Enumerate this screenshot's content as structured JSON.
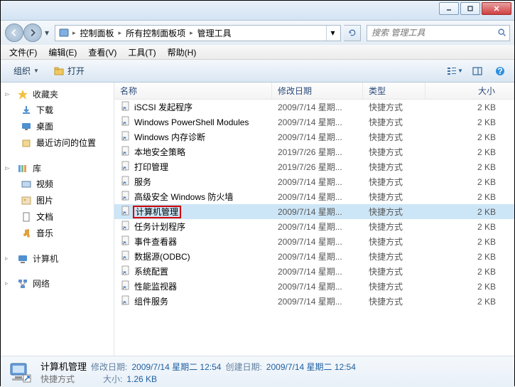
{
  "titlebar": {},
  "nav": {
    "breadcrumb": [
      "控制面板",
      "所有控制面板项",
      "管理工具"
    ],
    "search_placeholder": "搜索 管理工具"
  },
  "menu": {
    "file": "文件(F)",
    "edit": "编辑(E)",
    "view": "查看(V)",
    "tools": "工具(T)",
    "help": "帮助(H)"
  },
  "toolbar": {
    "organize": "组织",
    "open": "打开"
  },
  "sidebar": {
    "favorites": {
      "label": "收藏夹",
      "items": [
        "下载",
        "桌面",
        "最近访问的位置"
      ]
    },
    "libraries": {
      "label": "库",
      "items": [
        "视频",
        "图片",
        "文档",
        "音乐"
      ]
    },
    "computer": {
      "label": "计算机"
    },
    "network": {
      "label": "网络"
    }
  },
  "columns": {
    "name": "名称",
    "date": "修改日期",
    "type": "类型",
    "size": "大小"
  },
  "files": [
    {
      "name": "iSCSI 发起程序",
      "date": "2009/7/14 星期...",
      "type": "快捷方式",
      "size": "2 KB"
    },
    {
      "name": "Windows PowerShell Modules",
      "date": "2009/7/14 星期...",
      "type": "快捷方式",
      "size": "2 KB"
    },
    {
      "name": "Windows 内存诊断",
      "date": "2009/7/14 星期...",
      "type": "快捷方式",
      "size": "2 KB"
    },
    {
      "name": "本地安全策略",
      "date": "2019/7/26 星期...",
      "type": "快捷方式",
      "size": "2 KB"
    },
    {
      "name": "打印管理",
      "date": "2019/7/26 星期...",
      "type": "快捷方式",
      "size": "2 KB"
    },
    {
      "name": "服务",
      "date": "2009/7/14 星期...",
      "type": "快捷方式",
      "size": "2 KB"
    },
    {
      "name": "高级安全 Windows 防火墙",
      "date": "2009/7/14 星期...",
      "type": "快捷方式",
      "size": "2 KB"
    },
    {
      "name": "计算机管理",
      "date": "2009/7/14 星期...",
      "type": "快捷方式",
      "size": "2 KB",
      "selected": true,
      "highlighted": true
    },
    {
      "name": "任务计划程序",
      "date": "2009/7/14 星期...",
      "type": "快捷方式",
      "size": "2 KB"
    },
    {
      "name": "事件查看器",
      "date": "2009/7/14 星期...",
      "type": "快捷方式",
      "size": "2 KB"
    },
    {
      "name": "数据源(ODBC)",
      "date": "2009/7/14 星期...",
      "type": "快捷方式",
      "size": "2 KB"
    },
    {
      "name": "系统配置",
      "date": "2009/7/14 星期...",
      "type": "快捷方式",
      "size": "2 KB"
    },
    {
      "name": "性能监视器",
      "date": "2009/7/14 星期...",
      "type": "快捷方式",
      "size": "2 KB"
    },
    {
      "name": "组件服务",
      "date": "2009/7/14 星期...",
      "type": "快捷方式",
      "size": "2 KB"
    }
  ],
  "details": {
    "name": "计算机管理",
    "mod_label": "修改日期:",
    "mod_val": "2009/7/14 星期二 12:54",
    "created_label": "创建日期:",
    "created_val": "2009/7/14 星期二 12:54",
    "type": "快捷方式",
    "size_label": "大小:",
    "size_val": "1.26 KB"
  }
}
